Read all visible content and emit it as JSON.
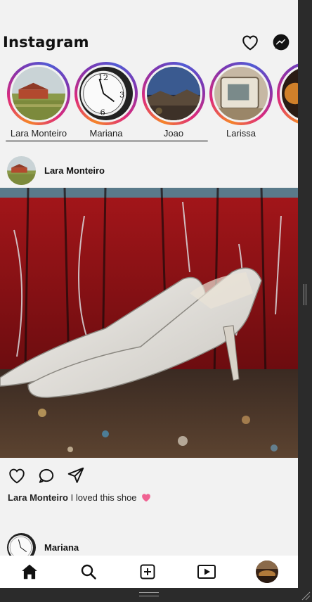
{
  "app": {
    "title": "Instagram",
    "icons": {
      "notifications": "heart-icon",
      "messages": "messenger-icon"
    }
  },
  "stories": [
    {
      "label": "Lara Monteiro",
      "image": "farm-barn-scene"
    },
    {
      "label": "Mariana",
      "image": "clock-face"
    },
    {
      "label": "Joao",
      "image": "desert-night"
    },
    {
      "label": "Larissa",
      "image": "old-car"
    },
    {
      "label": "",
      "image": "partial-story"
    }
  ],
  "post": {
    "username": "Lara Monteiro",
    "image": "white-high-heel-shoes-on-red-wall",
    "caption_user": "Lara Monteiro",
    "caption_text": "I loved this shoe",
    "caption_emoji": "pink-heart",
    "actions": [
      "like-icon",
      "comment-icon",
      "share-icon"
    ]
  },
  "next_post": {
    "username": "Mariana"
  },
  "bottom_nav": [
    "home-icon",
    "search-icon",
    "new-post-icon",
    "reels-icon",
    "profile-avatar"
  ],
  "colors": {
    "story_ring": [
      "#f58529",
      "#dd2a7b",
      "#8134af"
    ],
    "heart_emoji": "#f06292",
    "background": "#f2f2f2"
  }
}
